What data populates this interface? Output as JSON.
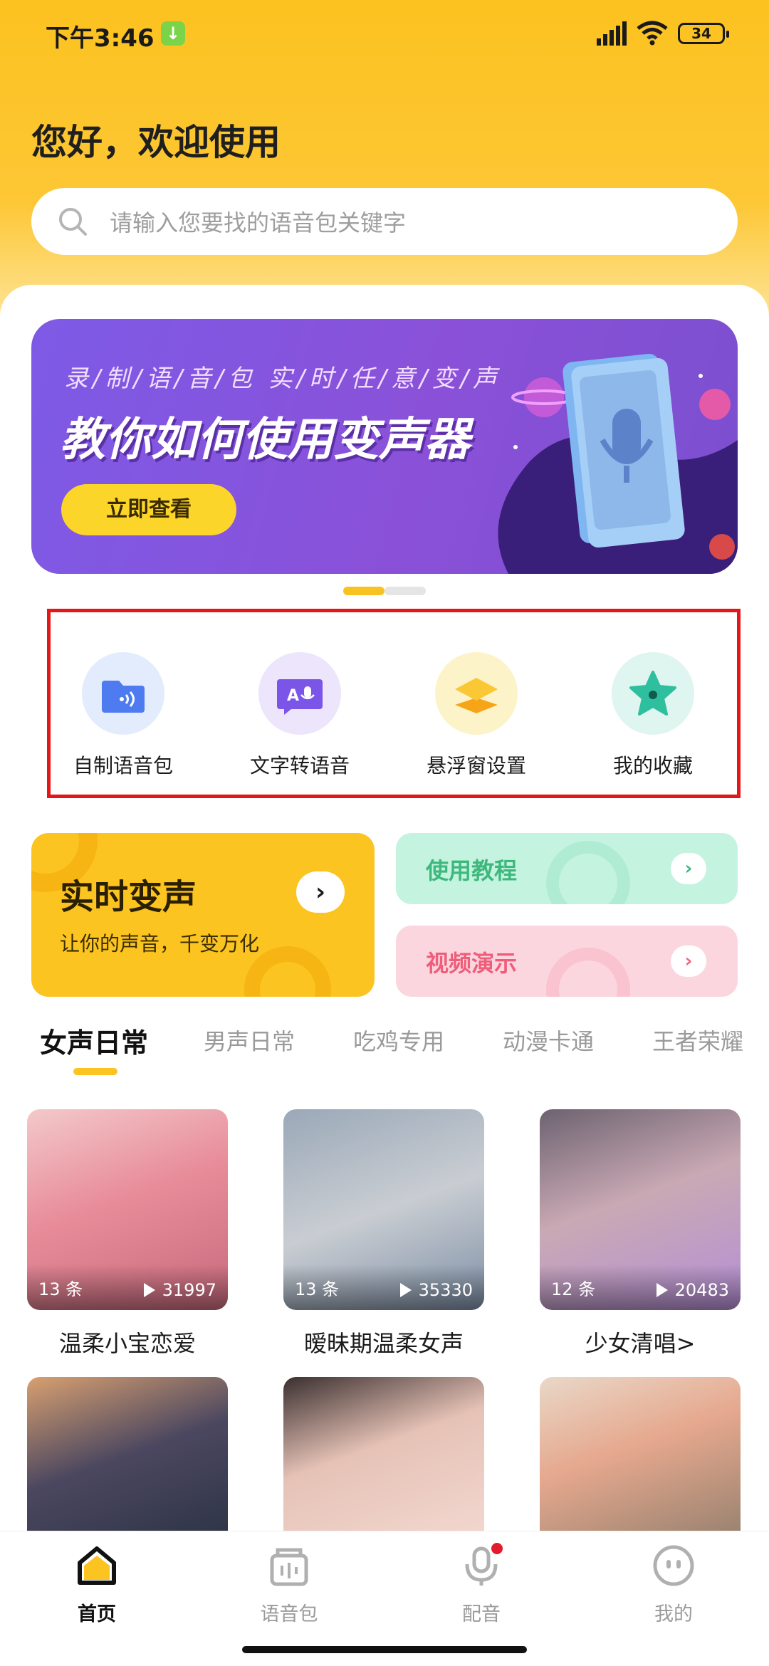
{
  "status_bar": {
    "time": "下午3:46",
    "download_badge": "↓",
    "battery": "34"
  },
  "greeting": "您好，欢迎使用",
  "search": {
    "placeholder": "请输入您要找的语音包关键字"
  },
  "banner": {
    "subtitle": "录/制/语/音/包    实/时/任/意/变/声",
    "title": "教你如何使用变声器",
    "button": "立即查看"
  },
  "quick_actions": [
    {
      "label": "自制语音包",
      "icon": "folder-voice-icon",
      "color": "#4f7bf0"
    },
    {
      "label": "文字转语音",
      "icon": "text-to-speech-icon",
      "color": "#7a55e8"
    },
    {
      "label": "悬浮窗设置",
      "icon": "layers-icon",
      "color": "#f8b51c"
    },
    {
      "label": "我的收藏",
      "icon": "star-icon",
      "color": "#2ebf9f"
    }
  ],
  "features": {
    "main": {
      "title": "实时变声",
      "subtitle": "让你的声音，千变万化",
      "arrow": "›"
    },
    "tutorial": {
      "label": "使用教程",
      "arrow": "›",
      "color": "#3fb87e"
    },
    "demo": {
      "label": "视频演示",
      "arrow": "›",
      "color": "#ee5d7a"
    }
  },
  "tabs": [
    "女声日常",
    "男声日常",
    "吃鸡专用",
    "动漫卡通",
    "王者荣耀"
  ],
  "cards": [
    {
      "count": "13 条",
      "plays": "31997",
      "title": "温柔小宝恋爱"
    },
    {
      "count": "13 条",
      "plays": "35330",
      "title": "暧昧期温柔女声"
    },
    {
      "count": "12 条",
      "plays": "20483",
      "title": "少女清唱>"
    }
  ],
  "bottom_nav": [
    {
      "label": "首页",
      "icon": "home-icon",
      "active": true
    },
    {
      "label": "语音包",
      "icon": "voice-pack-icon",
      "active": false
    },
    {
      "label": "配音",
      "icon": "microphone-icon",
      "active": false
    },
    {
      "label": "我的",
      "icon": "profile-icon",
      "active": false
    }
  ]
}
